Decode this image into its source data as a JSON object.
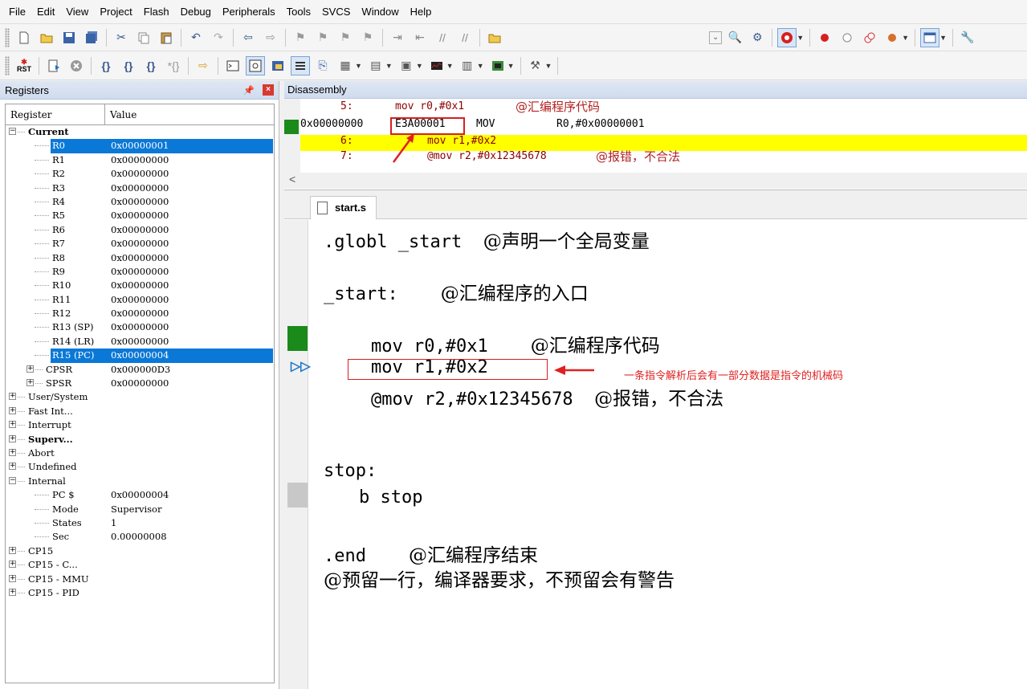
{
  "menu": [
    "File",
    "Edit",
    "View",
    "Project",
    "Flash",
    "Debug",
    "Peripherals",
    "Tools",
    "SVCS",
    "Window",
    "Help"
  ],
  "toolbar2_labels": {
    "rst": "RST"
  },
  "registers_panel": {
    "title": "Registers",
    "col_register": "Register",
    "col_value": "Value",
    "rows": [
      {
        "name": "Current",
        "value": "",
        "level": 0,
        "expander": "−",
        "bold": true
      },
      {
        "name": "R0",
        "value": "0x00000001",
        "level": 2,
        "selected": true
      },
      {
        "name": "R1",
        "value": "0x00000000",
        "level": 2
      },
      {
        "name": "R2",
        "value": "0x00000000",
        "level": 2
      },
      {
        "name": "R3",
        "value": "0x00000000",
        "level": 2
      },
      {
        "name": "R4",
        "value": "0x00000000",
        "level": 2
      },
      {
        "name": "R5",
        "value": "0x00000000",
        "level": 2
      },
      {
        "name": "R6",
        "value": "0x00000000",
        "level": 2
      },
      {
        "name": "R7",
        "value": "0x00000000",
        "level": 2
      },
      {
        "name": "R8",
        "value": "0x00000000",
        "level": 2
      },
      {
        "name": "R9",
        "value": "0x00000000",
        "level": 2
      },
      {
        "name": "R10",
        "value": "0x00000000",
        "level": 2
      },
      {
        "name": "R11",
        "value": "0x00000000",
        "level": 2
      },
      {
        "name": "R12",
        "value": "0x00000000",
        "level": 2
      },
      {
        "name": "R13 (SP)",
        "value": "0x00000000",
        "level": 2
      },
      {
        "name": "R14 (LR)",
        "value": "0x00000000",
        "level": 2
      },
      {
        "name": "R15 (PC)",
        "value": "0x00000004",
        "level": 2,
        "selected": true
      },
      {
        "name": "CPSR",
        "value": "0x000000D3",
        "level": 1,
        "expander": "+"
      },
      {
        "name": "SPSR",
        "value": "0x00000000",
        "level": 1,
        "expander": "+"
      },
      {
        "name": "User/System",
        "value": "",
        "level": 0,
        "expander": "+"
      },
      {
        "name": "Fast Int...",
        "value": "",
        "level": 0,
        "expander": "+"
      },
      {
        "name": "Interrupt",
        "value": "",
        "level": 0,
        "expander": "+"
      },
      {
        "name": "Superv...",
        "value": "",
        "level": 0,
        "expander": "+",
        "bold": true
      },
      {
        "name": "Abort",
        "value": "",
        "level": 0,
        "expander": "+"
      },
      {
        "name": "Undefined",
        "value": "",
        "level": 0,
        "expander": "+"
      },
      {
        "name": "Internal",
        "value": "",
        "level": 0,
        "expander": "−"
      },
      {
        "name": "PC  $",
        "value": "0x00000004",
        "level": 2
      },
      {
        "name": "Mode",
        "value": "Supervisor",
        "level": 2
      },
      {
        "name": "States",
        "value": "1",
        "level": 2
      },
      {
        "name": "Sec",
        "value": "0.00000008",
        "level": 2
      },
      {
        "name": "CP15",
        "value": "",
        "level": 0,
        "expander": "+"
      },
      {
        "name": "CP15 - C...",
        "value": "",
        "level": 0,
        "expander": "+"
      },
      {
        "name": "CP15 - MMU",
        "value": "",
        "level": 0,
        "expander": "+"
      },
      {
        "name": "CP15 - PID",
        "value": "",
        "level": 0,
        "expander": "+"
      }
    ]
  },
  "disassembly": {
    "title": "Disassembly",
    "line1_num": "5:",
    "line1_code": "mov r0,#0x1",
    "line1_comment": "@汇编程序代码",
    "line2_addr": "0x00000000",
    "line2_machine": "E3A00001",
    "line2_mnemonic": "MOV",
    "line2_operands": "R0,#0x00000001",
    "line3_num": "6:",
    "line3_code": "mov r1,#0x2",
    "line4_num": "7:",
    "line4_code": "@mov r2,#0x12345678",
    "line4_comment": "@报错，不合法",
    "scroll_left": "<"
  },
  "editor": {
    "tab_label": "start.s",
    "lines": {
      "l1_code": ".globl _start",
      "l1_comment": "@声明一个全局变量",
      "l2_code": "_start:",
      "l2_comment": "@汇编程序的入口",
      "l3_code": "mov r0,#0x1",
      "l3_comment": "@汇编程序代码",
      "l4_code": "mov r1,#0x2",
      "l5_code": "@mov r2,#0x12345678",
      "l5_comment": "@报错，不合法",
      "l6_code": "stop:",
      "l7_code": "b stop",
      "l8_code": ".end",
      "l8_comment": "@汇编程序结束",
      "l9_comment": "@预留一行，编译器要求，不预留会有警告"
    },
    "annotation": "一条指令解析后会有一部分数据是指令的机械码",
    "current_line_marker": "▷▷"
  },
  "colors": {
    "selection": "#0a78d7",
    "highlight_line": "#ffff00",
    "annotation_red": "#e02020",
    "pc_marker_green": "#1a8a1a"
  }
}
